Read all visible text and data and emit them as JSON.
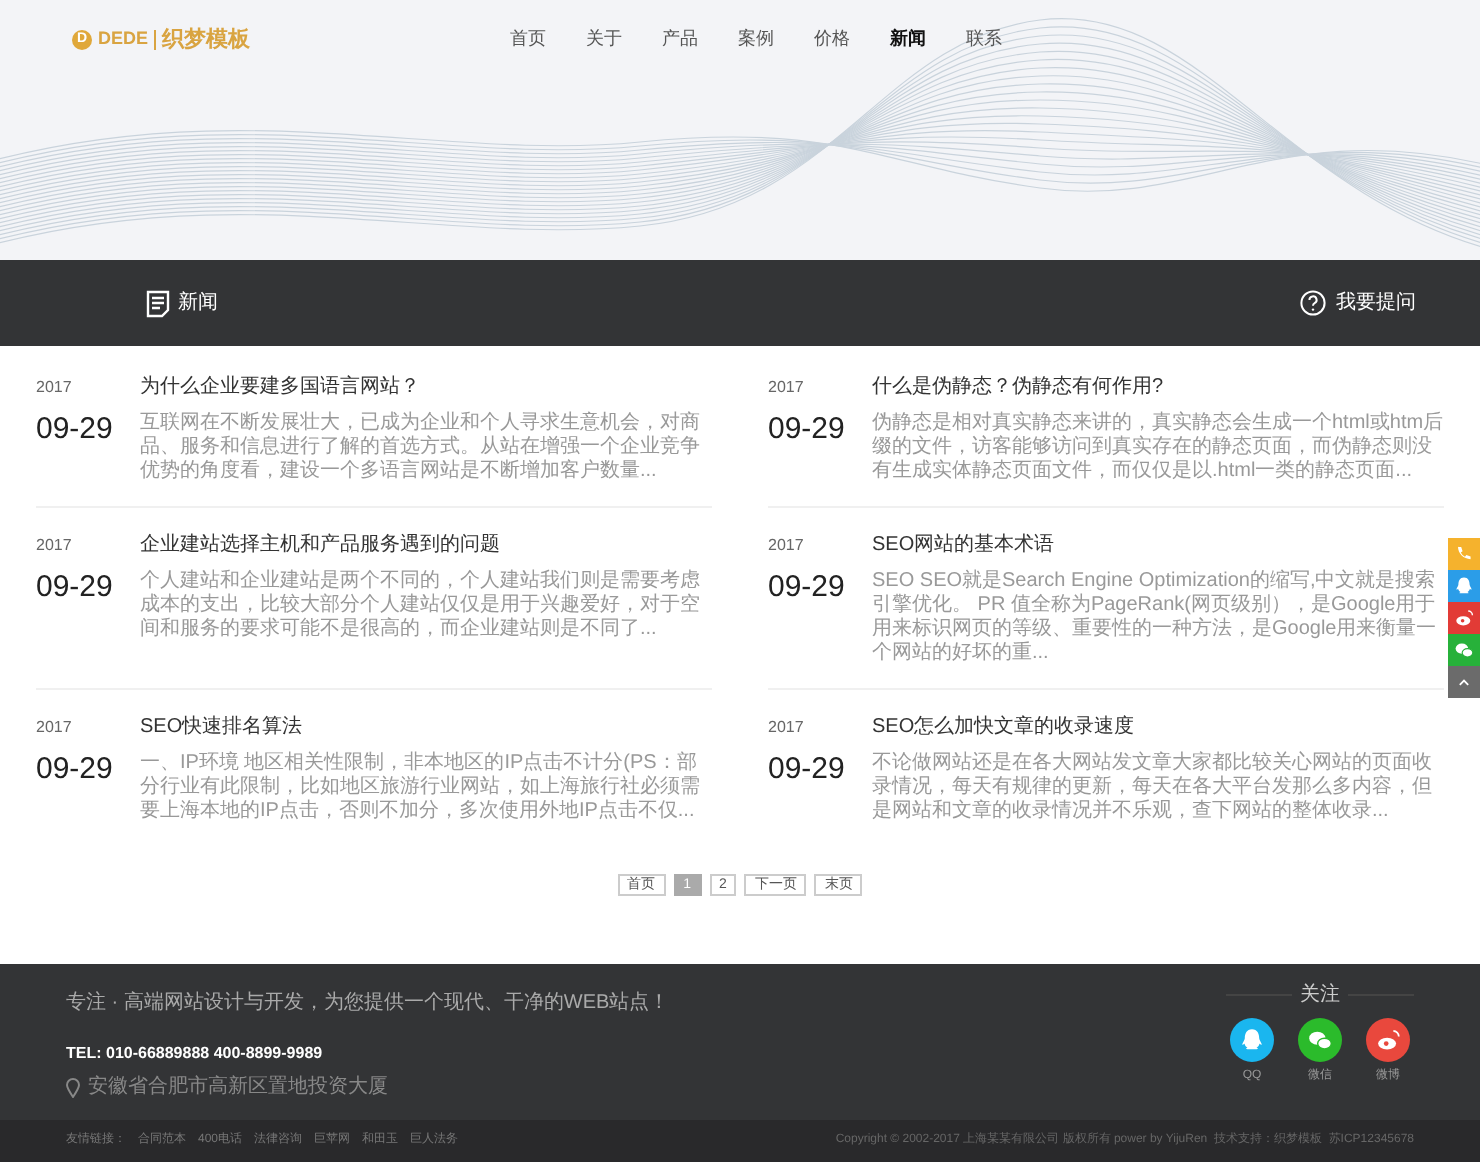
{
  "logo": {
    "mark": "D",
    "brand": "DEDE",
    "name": "织梦模板"
  },
  "nav": [
    {
      "label": "首页",
      "selected": false
    },
    {
      "label": "关于",
      "selected": false
    },
    {
      "label": "产品",
      "selected": false
    },
    {
      "label": "案例",
      "selected": false
    },
    {
      "label": "价格",
      "selected": false
    },
    {
      "label": "新闻",
      "selected": true
    },
    {
      "label": "联系",
      "selected": false
    }
  ],
  "section_bar": {
    "title": "新闻",
    "action": "我要提问"
  },
  "articles": [
    {
      "year": "2017",
      "date": "09-29",
      "title": "为什么企业要建多国语言网站？",
      "summary": "互联网在不断发展壮大，已成为企业和个人寻求生意机会，对商品、服务和信息进行了解的首选方式。从站在增强一个企业竞争优势的角度看，建设一个多语言网站是不断增加客户数量..."
    },
    {
      "year": "2017",
      "date": "09-29",
      "title": "什么是伪静态？伪静态有何作用?",
      "summary": "伪静态是相对真实静态来讲的，真实静态会生成一个html或htm后缀的文件，访客能够访问到真实存在的静态页面，而伪静态则没有生成实体静态页面文件，而仅仅是以.html一类的静态页面..."
    },
    {
      "year": "2017",
      "date": "09-29",
      "title": "企业建站选择主机和产品服务遇到的问题",
      "summary": "个人建站和企业建站是两个不同的，个人建站我们则是需要考虑成本的支出，比较大部分个人建站仅仅是用于兴趣爱好，对于空间和服务的要求可能不是很高的，而企业建站则是不同了..."
    },
    {
      "year": "2017",
      "date": "09-29",
      "title": "SEO网站的基本术语",
      "summary": "SEO SEO就是Search Engine Optimization的缩写,中文就是搜索引擎优化。 PR 值全称为PageRank(网页级别），是Google用于用来标识网页的等级、重要性的一种方法，是Google用来衡量一个网站的好坏的重..."
    },
    {
      "year": "2017",
      "date": "09-29",
      "title": "SEO快速排名算法",
      "summary": "一、IP环境 地区相关性限制，非本地区的IP点击不计分(PS：部分行业有此限制，比如地区旅游行业网站，如上海旅行社必须需要上海本地的IP点击，否则不加分，多次使用外地IP点击不仅..."
    },
    {
      "year": "2017",
      "date": "09-29",
      "title": "SEO怎么加快文章的收录速度",
      "summary": "不论做网站还是在各大网站发文章大家都比较关心网站的页面收录情况，每天有规律的更新，每天在各大平台发那么多内容，但是网站和文章的收录情况并不乐观，查下网站的整体收录..."
    }
  ],
  "pagination": [
    {
      "label": "首页",
      "selected": false
    },
    {
      "label": "1",
      "selected": true
    },
    {
      "label": "2",
      "selected": false
    },
    {
      "label": "下一页",
      "selected": false
    },
    {
      "label": "末页",
      "selected": false
    }
  ],
  "footer": {
    "slogan": "专注 · 高端网站设计与开发，为您提供一个现代、干净的WEB站点！",
    "phone": "TEL: 010-66889888 400-8899-9989",
    "address": "安徽省合肥市高新区置地投资大厦",
    "follow_title": "关注",
    "social": [
      {
        "kind": "qq",
        "label": "QQ",
        "color": "#1ab6ef"
      },
      {
        "kind": "wechat",
        "label": "微信",
        "color": "#2bbb2b"
      },
      {
        "kind": "weibo",
        "label": "微博",
        "color": "#e9483d"
      }
    ]
  },
  "bottom_bar": {
    "links_label": "友情链接：",
    "links": [
      "合同范本",
      "400电话",
      "法律咨询",
      "巨苹网",
      "和田玉",
      "巨人法务"
    ],
    "copyright": "Copyright © 2002-2017 上海某某有限公司 版权所有 power by YijuRen  技术支持：织梦模板  苏ICP12345678"
  },
  "side_tools": [
    {
      "kind": "phone",
      "color": "#f5b22d"
    },
    {
      "kind": "qq",
      "color": "#2b9de8"
    },
    {
      "kind": "weibo",
      "color": "#e23b36"
    },
    {
      "kind": "wechat",
      "color": "#27b13a"
    },
    {
      "kind": "top",
      "color": "#6b6b6b"
    }
  ]
}
